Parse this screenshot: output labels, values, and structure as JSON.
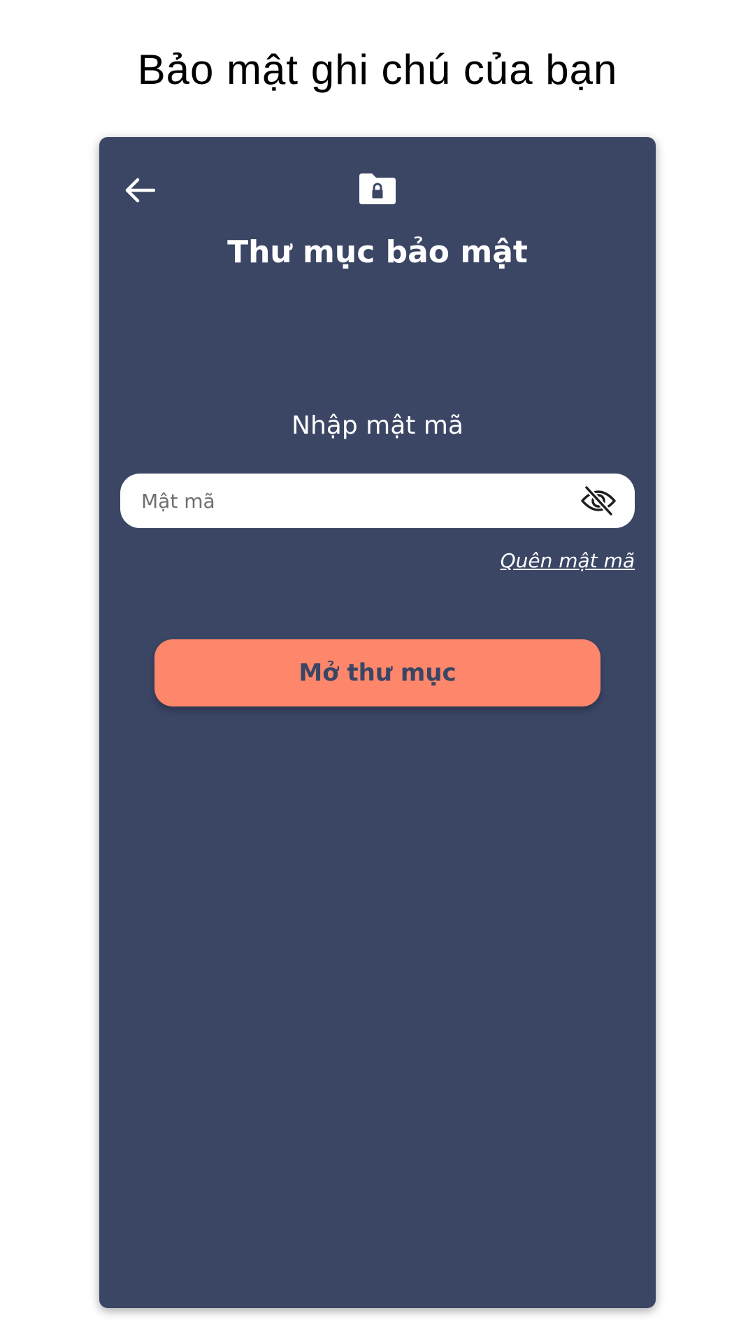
{
  "headline": "Bảo mật ghi chú của bạn",
  "screen": {
    "title": "Thư mục bảo mật",
    "back_icon": "arrow-left-icon",
    "folder_icon": "folder-lock-icon",
    "prompt": "Nhập mật mã",
    "password": {
      "placeholder": "Mật mã",
      "value": "",
      "visibility_icon": "eye-off-icon"
    },
    "forgot_link": "Quên mật mã",
    "open_button": "Mở thư mục"
  },
  "colors": {
    "background": "#3b4665",
    "accent": "#fd866b",
    "field": "#ffffff",
    "text_light": "#ffffff"
  }
}
